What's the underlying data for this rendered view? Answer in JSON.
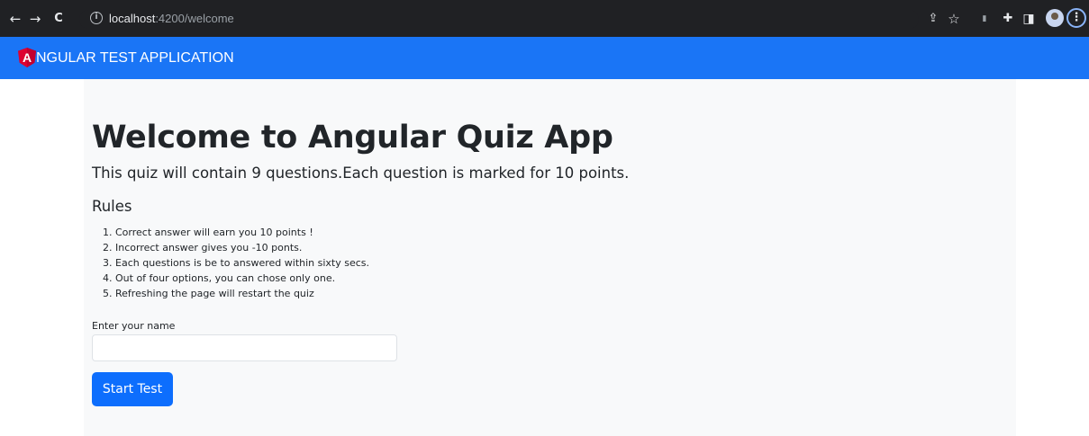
{
  "browser": {
    "url_host": "localhost",
    "url_path": ":4200/welcome",
    "back_icon": "←",
    "forward_icon": "→",
    "reload_icon": "C",
    "info_icon": "i",
    "share_icon": "⇪",
    "star_icon": "☆",
    "extension_icon": "▮",
    "puzzle_icon": "✚",
    "sidepanel_icon": "◨",
    "menu_icon": "⋮"
  },
  "navbar": {
    "brand": "NGULAR TEST APPLICATION",
    "logo_letter": "A"
  },
  "welcome": {
    "title": "Welcome to Angular Quiz App",
    "lead": "This quiz will contain 9 questions.Each question is marked for 10 points.",
    "rules_heading": "Rules",
    "rules": [
      "Correct answer will earn you 10 points !",
      "Incorrect answer gives you -10 ponts.",
      "Each questions is be to answered within sixty secs.",
      "Out of four options, you can chose only one.",
      "Refreshing the page will restart the quiz"
    ],
    "rule_numbers": [
      "1.",
      "2.",
      "3.",
      "4.",
      "5."
    ],
    "name_label": "Enter your name",
    "name_value": "",
    "start_button": "Start Test"
  },
  "colors": {
    "navbar": "#1a75f6",
    "button": "#0d6efd",
    "panel": "#f8f9fa",
    "chrome": "#202124"
  }
}
